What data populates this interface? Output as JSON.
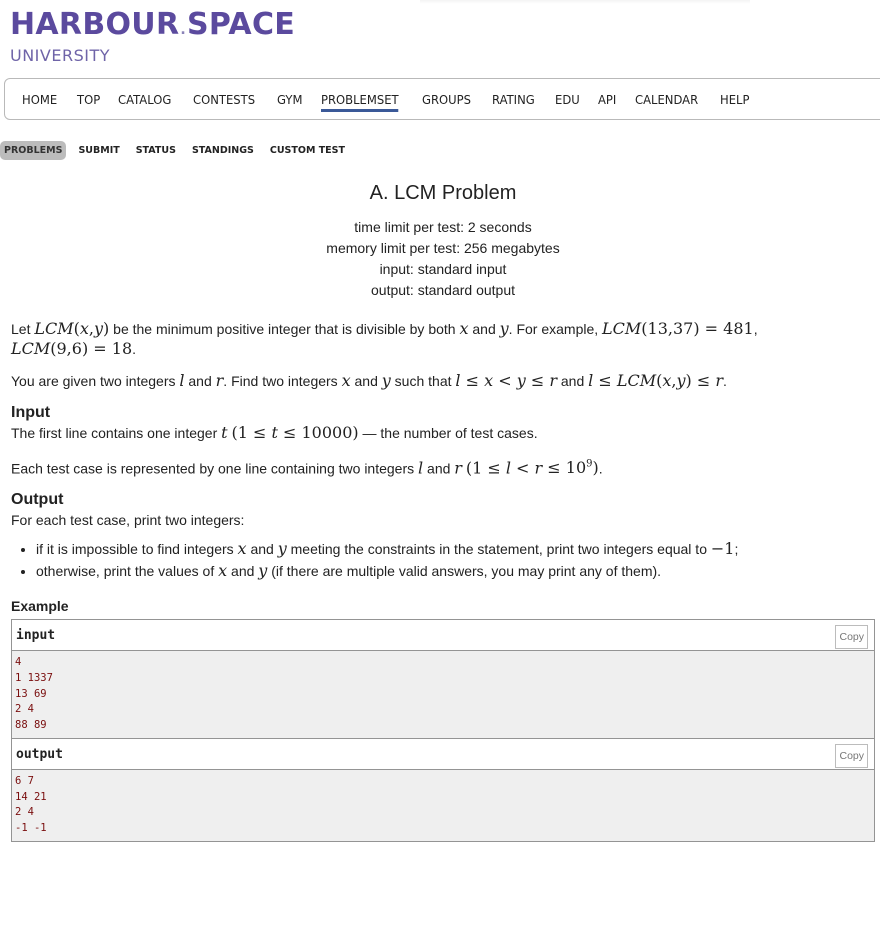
{
  "logo": {
    "main_left": "HARBOUR",
    "main_dot": ".",
    "main_right": "SPACE",
    "sub": "UNIVERSITY"
  },
  "menu": [
    "HOME",
    "TOP",
    "CATALOG",
    "CONTESTS",
    "GYM",
    "PROBLEMSET",
    "GROUPS",
    "RATING",
    "EDU",
    "API",
    "CALENDAR",
    "HELP"
  ],
  "menu_active": "PROBLEMSET",
  "subtabs": [
    "PROBLEMS",
    "SUBMIT",
    "STATUS",
    "STANDINGS",
    "CUSTOM TEST"
  ],
  "subtab_active": "PROBLEMS",
  "problem": {
    "title": "A. LCM Problem",
    "time_limit": "time limit per test: 2 seconds",
    "memory_limit": "memory limit per test: 256 megabytes",
    "input": "input: standard input",
    "output": "output: standard output",
    "input_title": "Input",
    "output_title": "Output",
    "output_intro": "For each test case, print two integers:",
    "example_title": "Example"
  },
  "sample": {
    "input_label": "input",
    "output_label": "output",
    "copy_label": "Copy",
    "input_text": "4\n1 1337\n13 69\n2 4\n88 89",
    "output_text": "6 7\n14 21\n2 4\n-1 -1"
  },
  "colors": {
    "brand": "#5b4a9e",
    "active_underline": "#3b5998",
    "sample_text": "#7a0e0e"
  }
}
